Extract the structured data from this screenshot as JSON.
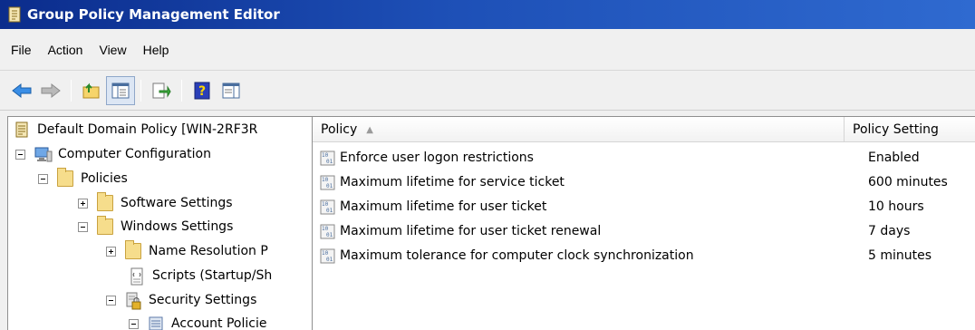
{
  "window": {
    "title": "Group Policy Management Editor"
  },
  "menu": {
    "items": [
      "File",
      "Action",
      "View",
      "Help"
    ]
  },
  "toolbar": {
    "buttons": [
      "back-icon",
      "forward-icon",
      "up-folder-icon",
      "show-hide-tree-icon",
      "export-list-icon",
      "help-icon",
      "properties-pane-icon"
    ]
  },
  "tree": {
    "items": [
      {
        "label": "Default Domain Policy [WIN-2RF3R",
        "icon": "policy-document-icon",
        "expander": "none"
      },
      {
        "label": "Computer Configuration",
        "icon": "computer-icon",
        "expander": "minus"
      },
      {
        "label": "Policies",
        "icon": "folder-icon",
        "expander": "minus"
      },
      {
        "label": "Software Settings",
        "icon": "folder-icon",
        "expander": "plus"
      },
      {
        "label": "Windows Settings",
        "icon": "folder-icon",
        "expander": "minus"
      },
      {
        "label": "Name Resolution P",
        "icon": "folder-icon",
        "expander": "plus"
      },
      {
        "label": "Scripts (Startup/Sh",
        "icon": "script-icon",
        "expander": "none"
      },
      {
        "label": "Security Settings",
        "icon": "security-icon",
        "expander": "minus"
      },
      {
        "label": "Account Policie",
        "icon": "account-policy-icon",
        "expander": "minus"
      }
    ]
  },
  "list": {
    "columns": {
      "policy": "Policy",
      "setting": "Policy Setting"
    },
    "sort_indicator": "▲",
    "rows": [
      {
        "policy": "Enforce user logon restrictions",
        "setting": "Enabled"
      },
      {
        "policy": "Maximum lifetime for service ticket",
        "setting": "600 minutes"
      },
      {
        "policy": "Maximum lifetime for user ticket",
        "setting": "10 hours"
      },
      {
        "policy": "Maximum lifetime for user ticket renewal",
        "setting": "7 days"
      },
      {
        "policy": "Maximum tolerance for computer clock synchronization",
        "setting": "5 minutes"
      }
    ]
  },
  "colors": {
    "titlebar": "#0b2c8c",
    "selection": "#dce6f4"
  }
}
